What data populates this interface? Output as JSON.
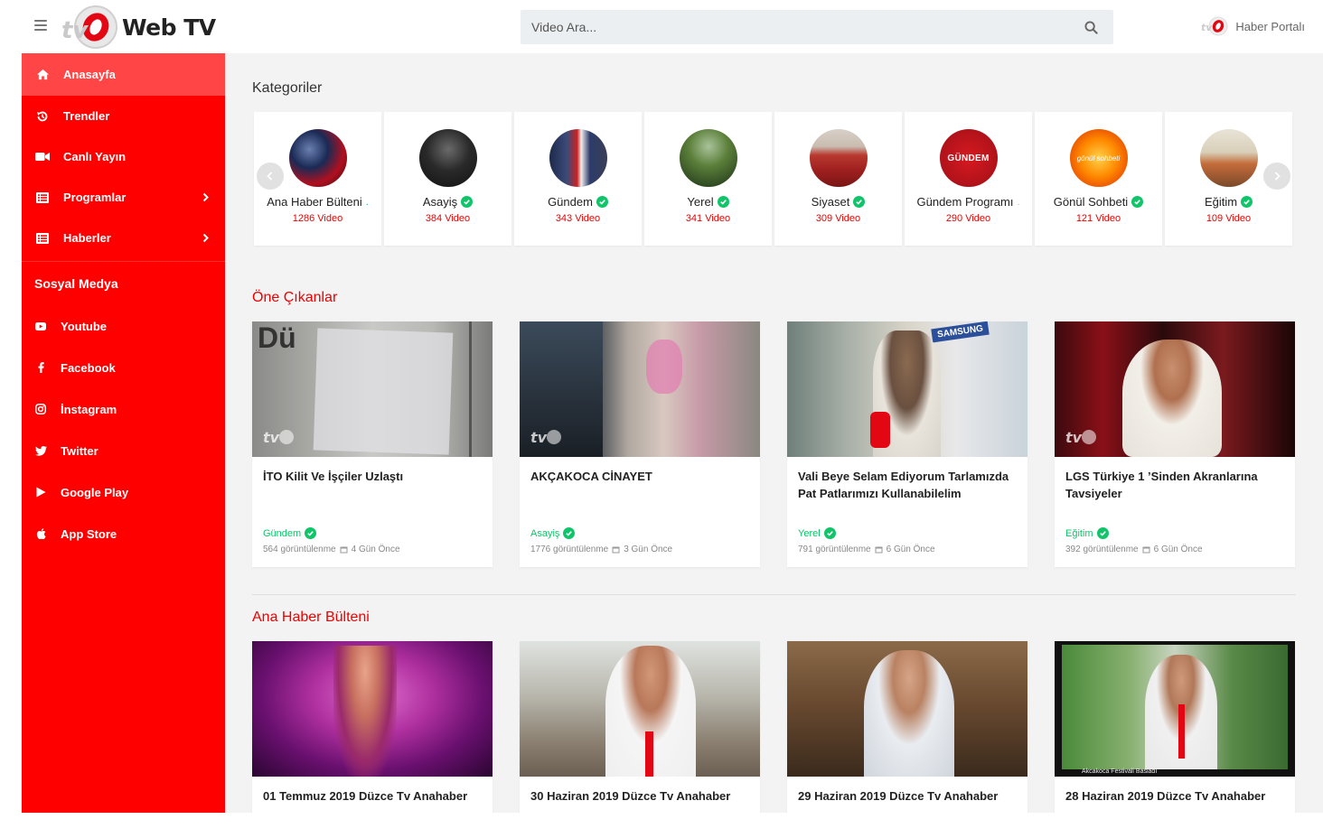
{
  "header": {
    "logo_text": "Web TV",
    "search_placeholder": "Video Ara...",
    "portal_label": "Haber Portalı"
  },
  "sidebar": {
    "nav": [
      {
        "label": "Anasayfa",
        "icon": "home-icon",
        "active": true
      },
      {
        "label": "Trendler",
        "icon": "history-icon"
      },
      {
        "label": "Canlı Yayın",
        "icon": "video-camera-icon"
      },
      {
        "label": "Programlar",
        "icon": "list-icon",
        "has_children": true
      },
      {
        "label": "Haberler",
        "icon": "list-icon",
        "has_children": true
      }
    ],
    "social_heading": "Sosyal Medya",
    "social": [
      {
        "label": "Youtube",
        "icon": "youtube-icon"
      },
      {
        "label": "Facebook",
        "icon": "facebook-icon"
      },
      {
        "label": "İnstagram",
        "icon": "instagram-icon"
      },
      {
        "label": "Twitter",
        "icon": "twitter-icon"
      },
      {
        "label": "Google Play",
        "icon": "google-play-icon"
      },
      {
        "label": "App Store",
        "icon": "apple-icon"
      }
    ]
  },
  "categories": {
    "title": "Kategoriler",
    "items": [
      {
        "name": "Ana Haber Bülteni",
        "count": "1286 Video"
      },
      {
        "name": "Asayiş",
        "count": "384 Video"
      },
      {
        "name": "Gündem",
        "count": "343 Video"
      },
      {
        "name": "Yerel",
        "count": "341 Video"
      },
      {
        "name": "Siyaset",
        "count": "309 Video"
      },
      {
        "name": "Gündem Programı",
        "count": "290 Video"
      },
      {
        "name": "Gönül Sohbeti",
        "count": "121 Video"
      },
      {
        "name": "Eğitim",
        "count": "109 Video"
      }
    ],
    "thumb_text_gundem": "GÜNDEM",
    "thumb_text_sohbet": "gönül sohbeti"
  },
  "featured": {
    "title": "Öne Çıkanlar",
    "videos": [
      {
        "title": "İTO Kilit Ve İşçiler Uzlaştı",
        "category": "Gündem",
        "views": "564 görüntülenme",
        "date": "4 Gün Önce"
      },
      {
        "title": "AKÇAKOCA CİNAYET",
        "category": "Asayiş",
        "views": "1776 görüntülenme",
        "date": "3 Gün Önce"
      },
      {
        "title": "Vali Beye Selam Ediyorum Tarlamızda Pat Patlarımızı Kullanabilelim",
        "category": "Yerel",
        "views": "791 görüntülenme",
        "date": "6 Gün Önce"
      },
      {
        "title": "LGS Türkiye 1 ’Sinden Akranlarına Tavsiyeler",
        "category": "Eğitim",
        "views": "392 görüntülenme",
        "date": "6 Gün Önce"
      }
    ]
  },
  "news": {
    "title": "Ana Haber Bülteni",
    "videos": [
      {
        "title": "01 Temmuz 2019 Düzce Tv Anahaber"
      },
      {
        "title": "30 Haziran 2019 Düzce Tv Anahaber"
      },
      {
        "title": "29 Haziran 2019 Düzce Tv Anahaber"
      },
      {
        "title": "28 Haziran 2019 Düzce Tv Anahaber"
      }
    ]
  },
  "thumbnail_texts": {
    "doc_sign": "Dü",
    "store_sign": "SAMSUNG",
    "caption": "Akcakoca Festivali Basladı"
  },
  "colors": {
    "brand_red": "#ff0000",
    "active_red": "#ff4545",
    "verified_green": "#10c469"
  }
}
